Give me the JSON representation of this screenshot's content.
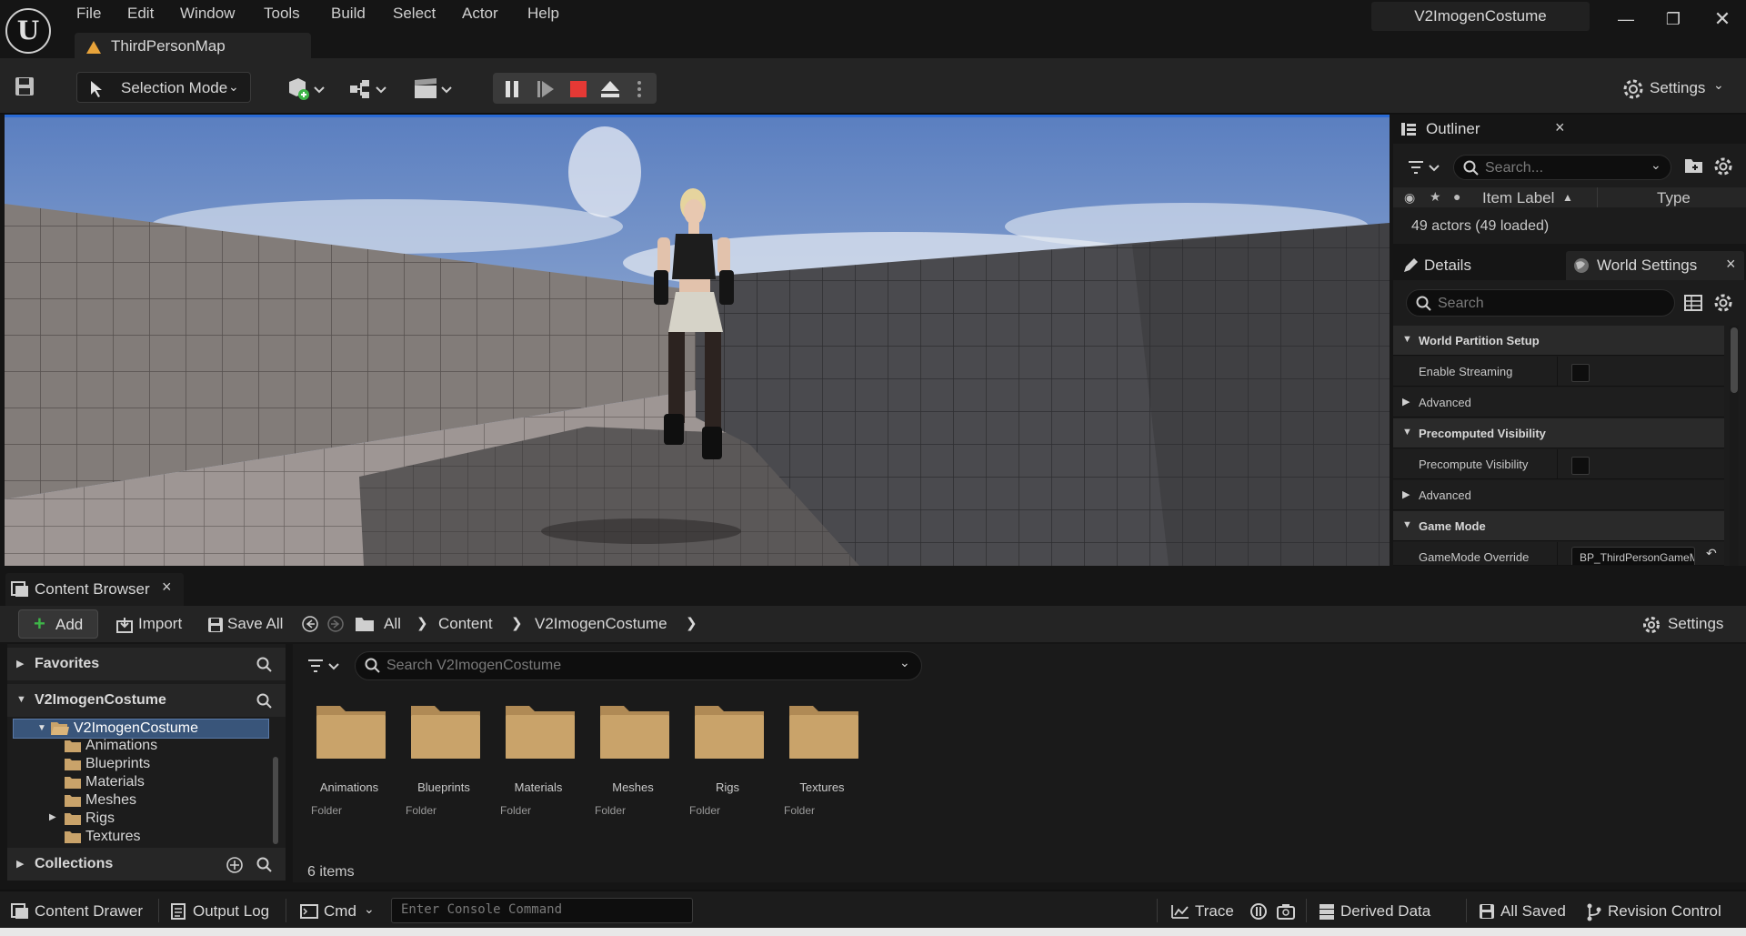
{
  "titlebar": {
    "menu": [
      "File",
      "Edit",
      "Window",
      "Tools",
      "Build",
      "Select",
      "Actor",
      "Help"
    ],
    "map_tab": "ThirdPersonMap",
    "project": "V2ImogenCostume"
  },
  "toolbar": {
    "mode": "Selection Mode",
    "settings": "Settings"
  },
  "outliner": {
    "title": "Outliner",
    "search_placeholder": "Search...",
    "col_label": "Item Label",
    "col_type": "Type",
    "count": "49 actors (49 loaded)"
  },
  "details": {
    "tab_details": "Details",
    "tab_world": "World Settings",
    "search_placeholder": "Search",
    "rows": [
      {
        "kind": "cat",
        "label": "World Partition Setup"
      },
      {
        "kind": "check",
        "label": "Enable Streaming"
      },
      {
        "kind": "sub",
        "label": "Advanced"
      },
      {
        "kind": "cat",
        "label": "Precomputed Visibility"
      },
      {
        "kind": "check",
        "label": "Precompute Visibility"
      },
      {
        "kind": "sub",
        "label": "Advanced"
      },
      {
        "kind": "cat",
        "label": "Game Mode"
      },
      {
        "kind": "combo",
        "label": "GameMode Override",
        "value": "BP_ThirdPersonGameMode"
      }
    ]
  },
  "content_browser": {
    "tab": "Content Browser",
    "add": "Add",
    "import": "Import",
    "save_all": "Save All",
    "breadcrumbs": [
      "All",
      "Content",
      "V2ImogenCostume"
    ],
    "settings": "Settings",
    "favorites": "Favorites",
    "root": "V2ImogenCostume",
    "tree_root": "V2ImogenCostume",
    "tree": [
      "Animations",
      "Blueprints",
      "Materials",
      "Meshes",
      "Rigs",
      "Textures"
    ],
    "collections": "Collections",
    "search_placeholder": "Search V2ImogenCostume",
    "folders": [
      {
        "name": "Animations",
        "type": "Folder"
      },
      {
        "name": "Blueprints",
        "type": "Folder"
      },
      {
        "name": "Materials",
        "type": "Folder"
      },
      {
        "name": "Meshes",
        "type": "Folder"
      },
      {
        "name": "Rigs",
        "type": "Folder"
      },
      {
        "name": "Textures",
        "type": "Folder"
      }
    ],
    "count": "6 items"
  },
  "statusbar": {
    "content_drawer": "Content Drawer",
    "output_log": "Output Log",
    "cmd": "Cmd",
    "console_placeholder": "Enter Console Command",
    "trace": "Trace",
    "derived_data": "Derived Data",
    "all_saved": "All Saved",
    "revision_control": "Revision Control"
  },
  "colors": {
    "accent_blue": "#2a6bd6",
    "stop_red": "#e53935",
    "folder": "#c9a36a",
    "selection": "#39557a"
  }
}
